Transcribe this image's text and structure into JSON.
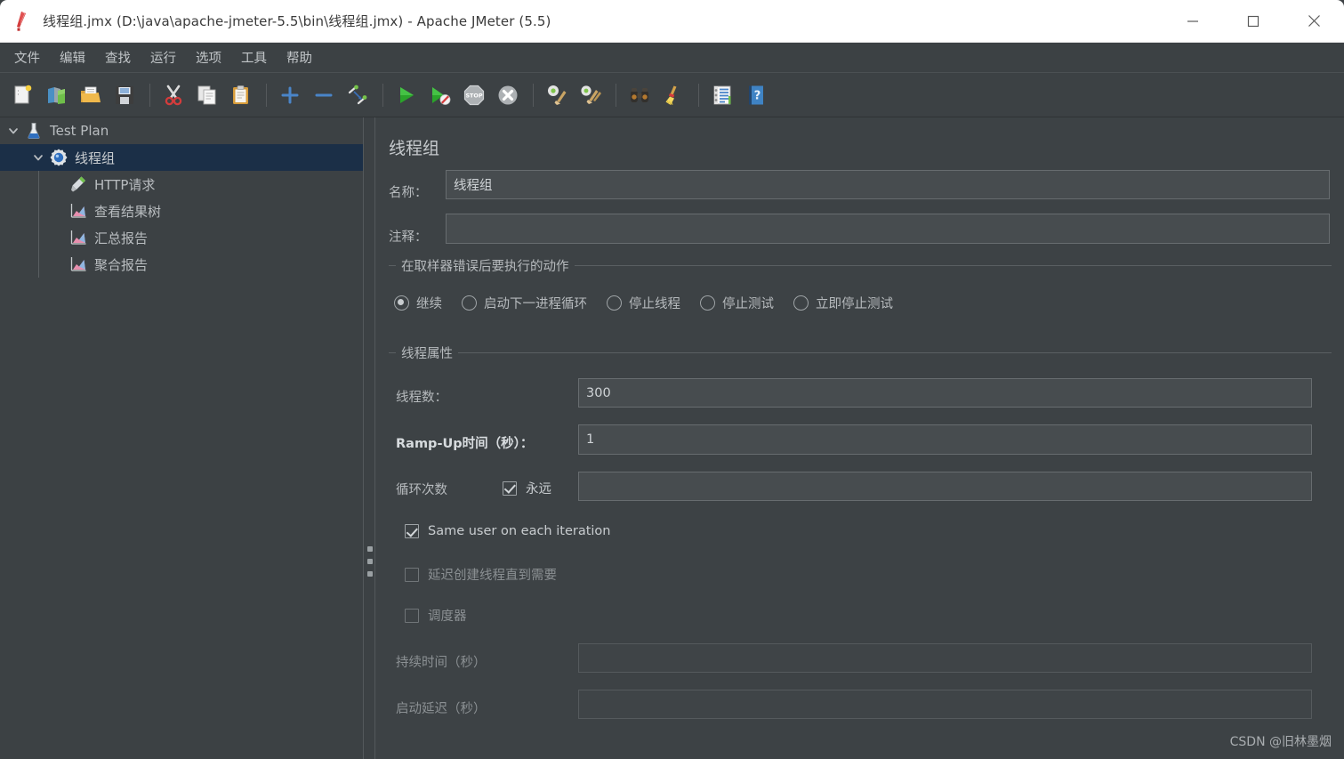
{
  "window": {
    "title": "线程组.jmx (D:\\java\\apache-jmeter-5.5\\bin\\线程组.jmx) - Apache JMeter (5.5)",
    "app_icon": "jmeter-feather-icon",
    "minimize_label": "—",
    "maximize_label": "▢",
    "close_label": "✕"
  },
  "menubar": {
    "items": [
      {
        "label": "文件",
        "name": "menu-file"
      },
      {
        "label": "编辑",
        "name": "menu-edit"
      },
      {
        "label": "查找",
        "name": "menu-search"
      },
      {
        "label": "运行",
        "name": "menu-run"
      },
      {
        "label": "选项",
        "name": "menu-options"
      },
      {
        "label": "工具",
        "name": "menu-tools"
      },
      {
        "label": "帮助",
        "name": "menu-help"
      }
    ]
  },
  "toolbar": {
    "buttons": [
      {
        "icon": "new-file-icon",
        "name": "toolbar-new"
      },
      {
        "icon": "templates-icon",
        "name": "toolbar-templates"
      },
      {
        "icon": "open-folder-icon",
        "name": "toolbar-open"
      },
      {
        "icon": "save-floppy-icon",
        "name": "toolbar-save"
      },
      {
        "sep": true
      },
      {
        "icon": "cut-scissors-icon",
        "name": "toolbar-cut"
      },
      {
        "icon": "copy-icon",
        "name": "toolbar-copy"
      },
      {
        "icon": "paste-clipboard-icon",
        "name": "toolbar-paste"
      },
      {
        "sep": true
      },
      {
        "icon": "plus-icon",
        "name": "toolbar-expand-all"
      },
      {
        "icon": "minus-icon",
        "name": "toolbar-collapse-all"
      },
      {
        "icon": "toggle-icon",
        "name": "toolbar-toggle"
      },
      {
        "sep": true
      },
      {
        "icon": "play-green-icon",
        "name": "toolbar-start"
      },
      {
        "icon": "play-no-timers-icon",
        "name": "toolbar-start-no-pauses"
      },
      {
        "icon": "stop-sign-icon",
        "name": "toolbar-stop"
      },
      {
        "icon": "shutdown-icon",
        "name": "toolbar-shutdown"
      },
      {
        "sep": true
      },
      {
        "icon": "clear-broom-icon",
        "name": "toolbar-clear"
      },
      {
        "icon": "clear-all-broom-icon",
        "name": "toolbar-clear-all"
      },
      {
        "sep": true
      },
      {
        "icon": "binoculars-search-icon",
        "name": "toolbar-search"
      },
      {
        "icon": "broom-reset-icon",
        "name": "toolbar-reset-search"
      },
      {
        "sep": true
      },
      {
        "icon": "function-helper-icon",
        "name": "toolbar-function-helper"
      },
      {
        "icon": "help-book-icon",
        "name": "toolbar-help"
      }
    ]
  },
  "tree": {
    "nodes": [
      {
        "label": "Test Plan",
        "icon": "test-plan-icon",
        "depth": 0,
        "expanded": true,
        "selected": false
      },
      {
        "label": "线程组",
        "icon": "thread-group-gear-icon",
        "depth": 1,
        "expanded": true,
        "selected": true
      },
      {
        "label": "HTTP请求",
        "icon": "http-sampler-icon",
        "depth": 2,
        "expanded": null,
        "selected": false
      },
      {
        "label": "查看结果树",
        "icon": "listener-chart-icon",
        "depth": 2,
        "expanded": null,
        "selected": false
      },
      {
        "label": "汇总报告",
        "icon": "listener-chart-icon",
        "depth": 2,
        "expanded": null,
        "selected": false
      },
      {
        "label": "聚合报告",
        "icon": "listener-chart-icon",
        "depth": 2,
        "expanded": null,
        "selected": false
      }
    ]
  },
  "main": {
    "title": "线程组",
    "name_label": "名称：",
    "name_value": "线程组",
    "comment_label": "注释：",
    "comment_value": "",
    "error_action": {
      "group_title": "在取样器错误后要执行的动作",
      "options": [
        {
          "label": "继续",
          "selected": true,
          "name": "radio-continue"
        },
        {
          "label": "启动下一进程循环",
          "selected": false,
          "name": "radio-start-next-loop"
        },
        {
          "label": "停止线程",
          "selected": false,
          "name": "radio-stop-thread"
        },
        {
          "label": "停止测试",
          "selected": false,
          "name": "radio-stop-test"
        },
        {
          "label": "立即停止测试",
          "selected": false,
          "name": "radio-stop-test-now"
        }
      ]
    },
    "thread_props": {
      "group_title": "线程属性",
      "threads_label": "线程数：",
      "threads_value": "300",
      "rampup_label": "Ramp-Up时间（秒）：",
      "rampup_value": "1",
      "loops_label": "循环次数",
      "forever_label": "永远",
      "forever_checked": true,
      "loops_value": "",
      "same_user_label": "Same user on each iteration",
      "same_user_checked": true,
      "delay_create_label": "延迟创建线程直到需要",
      "delay_create_checked": false,
      "scheduler_label": "调度器",
      "scheduler_checked": false,
      "duration_label": "持续时间（秒）",
      "duration_value": "",
      "startup_delay_label": "启动延迟（秒）",
      "startup_delay_value": ""
    }
  },
  "watermark": "CSDN @旧林墨烟"
}
